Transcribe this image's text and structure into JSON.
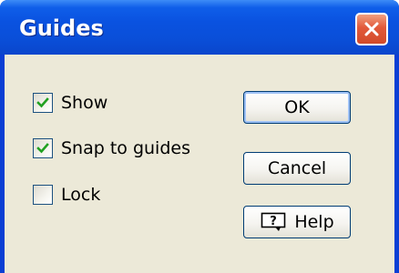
{
  "window": {
    "title": "Guides"
  },
  "checkboxes": [
    {
      "label": "Show",
      "checked": true
    },
    {
      "label": "Snap to guides",
      "checked": true
    },
    {
      "label": "Lock",
      "checked": false
    }
  ],
  "buttons": {
    "ok_label": "OK",
    "cancel_label": "Cancel",
    "help_label": "Help"
  },
  "icons": {
    "close": "close-icon",
    "help": "help-icon",
    "check": "checkmark-icon"
  },
  "colors": {
    "title_bar": "#0a52e0",
    "client_background": "#ece9d8",
    "close_button": "#e2593a",
    "checkmark": "#21a121",
    "button_border": "#003c74"
  }
}
